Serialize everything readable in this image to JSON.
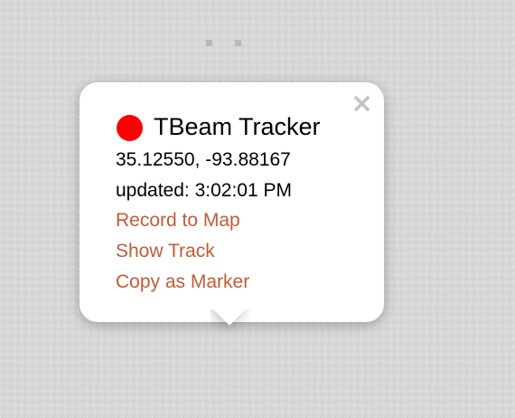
{
  "popup": {
    "close_icon": "close-icon",
    "status_color": "#ff0000",
    "title": "TBeam Tracker",
    "coordinates": "35.12550, -93.88167",
    "updated": "updated: 3:02:01 PM",
    "actions": [
      {
        "label": "Record to Map"
      },
      {
        "label": "Show Track"
      },
      {
        "label": "Copy as Marker"
      }
    ],
    "link_color": "#c35b35"
  }
}
